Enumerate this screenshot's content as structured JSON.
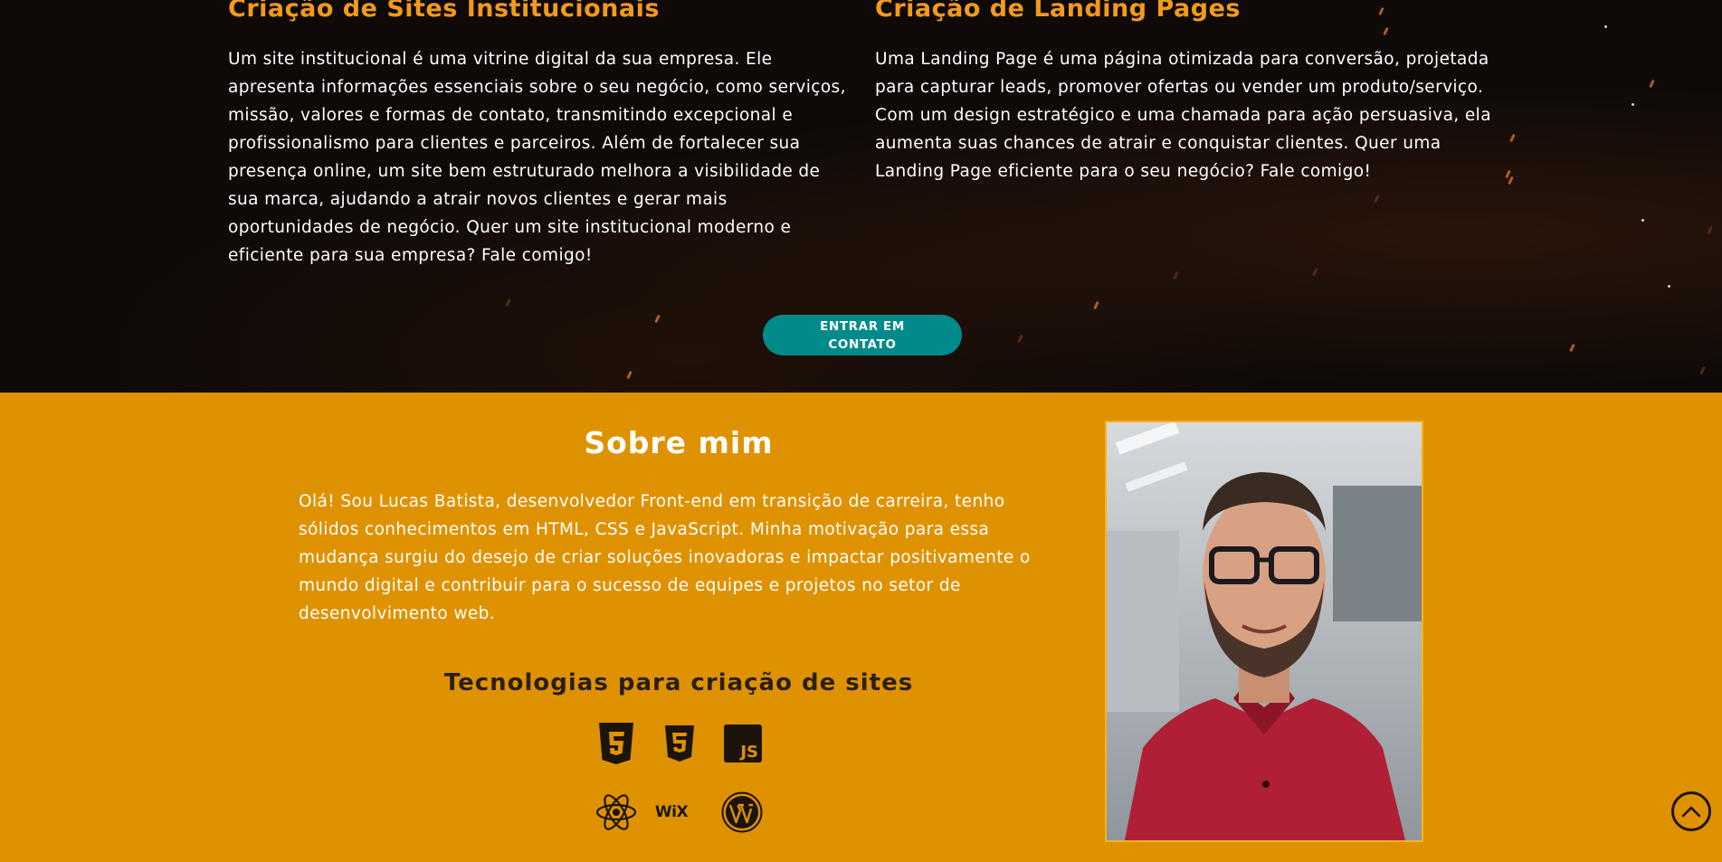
{
  "services": {
    "institutional": {
      "title": "Criação de Sites Institucionais",
      "text": "Um site institucional é uma vitrine digital da sua empresa. Ele apresenta informações essenciais sobre o seu negócio, como serviços, missão, valores e formas de contato, transmitindo excepcional e profissionalismo para clientes e parceiros. Além de fortalecer sua presença online, um site bem estruturado melhora a visibilidade de sua marca, ajudando a atrair novos clientes e gerar mais oportunidades de negócio. Quer um site institucional moderno e eficiente para sua empresa? Fale comigo!"
    },
    "landing": {
      "title": "Criação de Landing Pages",
      "text": "Uma Landing Page é uma página otimizada para conversão, projetada para capturar leads, promover ofertas ou vender um produto/serviço. Com um design estratégico e uma chamada para ação persuasiva, ela aumenta suas chances de atrair e conquistar clientes. Quer uma Landing Page eficiente para o seu negócio? Fale comigo!"
    },
    "contact_button": "ENTRAR EM CONTATO"
  },
  "about": {
    "title": "Sobre mim",
    "bio": "Olá! Sou Lucas Batista, desenvolvedor Front-end em transição de carreira, tenho sólidos conhecimentos em HTML, CSS e JavaScript. Minha motivação para essa mudança surgiu do desejo de criar soluções inovadoras e impactar positivamente o mundo digital e contribuir para o sucesso de equipes e projetos no setor de desenvolvimento web.",
    "tech_title": "Tecnologias para criação de sites",
    "tech_icons": [
      "html5-icon",
      "css3-icon",
      "javascript-icon",
      "react-icon",
      "wix-icon",
      "wordpress-icon"
    ],
    "wix_label": "WiX",
    "js_label": "JS"
  },
  "colors": {
    "accent_orange": "#f29a1b",
    "about_bg": "#df9200",
    "button_teal": "#008a8a",
    "dark_bg": "#0f0a08"
  }
}
